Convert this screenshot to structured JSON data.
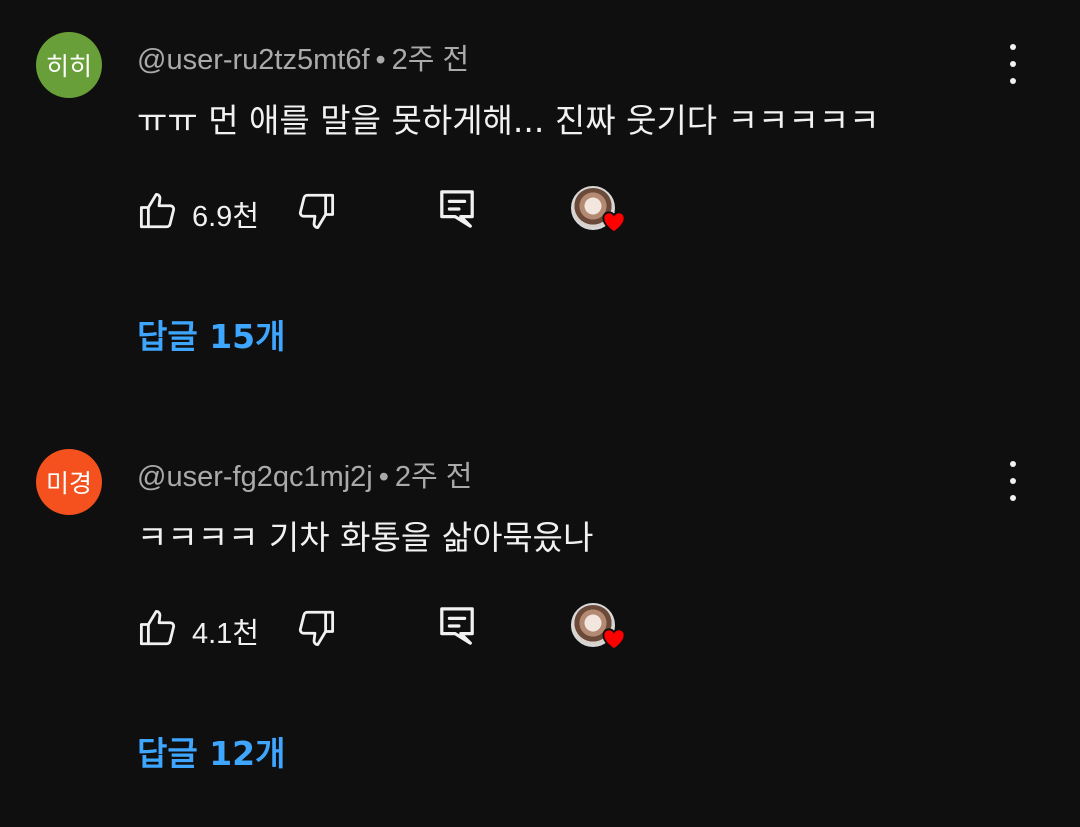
{
  "comments": [
    {
      "avatar_text": "히히",
      "avatar_color": "#689f38",
      "username": "@user-ru2tz5mt6f",
      "separator": "•",
      "time": "2주 전",
      "text": "ㅠㅠ 먼 애를 말을 못하게해... 진짜 웃기다 ㅋㅋㅋㅋㅋ",
      "like_count": "6.9천",
      "replies_label": "답글 15개",
      "icons": [
        "like-icon",
        "dislike-icon",
        "reply-icon",
        "creator-heart-icon",
        "more-vert-icon"
      ]
    },
    {
      "avatar_text": "미경",
      "avatar_color": "#f4511e",
      "username": "@user-fg2qc1mj2j",
      "separator": "•",
      "time": "2주 전",
      "text": "ㅋㅋㅋㅋ 기차 화통을 삶아묵읐나",
      "like_count": "4.1천",
      "replies_label": "답글 12개",
      "icons": [
        "like-icon",
        "dislike-icon",
        "reply-icon",
        "creator-heart-icon",
        "more-vert-icon"
      ]
    }
  ],
  "colors": {
    "background": "#0f0f0f",
    "primary_text": "#f1f1f1",
    "secondary_text": "#aaaaaa",
    "replies_link": "#3ea6ff",
    "heart": "#ff0000"
  }
}
